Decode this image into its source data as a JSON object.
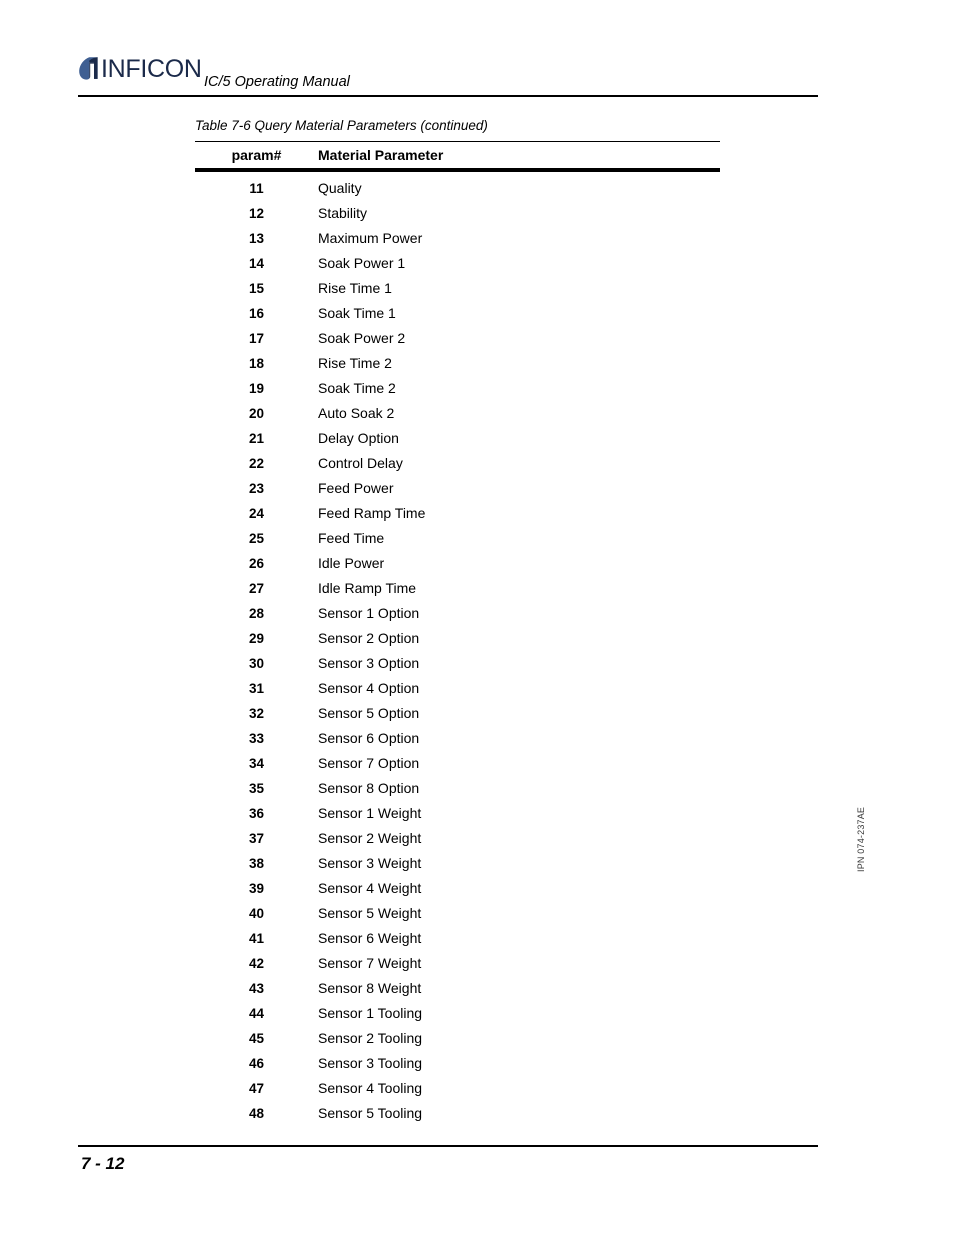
{
  "header": {
    "logo_text": "INFICON",
    "logo_icon": "inficon-droplet-logo",
    "logo_color": "#3f5f92",
    "logo_word_color": "#1b2a4a",
    "manual_title": "IC/5 Operating Manual"
  },
  "table": {
    "caption": "Table 7-6  Query Material Parameters (continued)",
    "columns": [
      "param#",
      "Material Parameter"
    ],
    "rows": [
      {
        "num": "11",
        "name": "Quality"
      },
      {
        "num": "12",
        "name": "Stability"
      },
      {
        "num": "13",
        "name": "Maximum Power"
      },
      {
        "num": "14",
        "name": "Soak Power 1"
      },
      {
        "num": "15",
        "name": "Rise Time 1"
      },
      {
        "num": "16",
        "name": "Soak Time 1"
      },
      {
        "num": "17",
        "name": "Soak Power 2"
      },
      {
        "num": "18",
        "name": "Rise Time 2"
      },
      {
        "num": "19",
        "name": "Soak Time 2"
      },
      {
        "num": "20",
        "name": "Auto Soak 2"
      },
      {
        "num": "21",
        "name": "Delay Option"
      },
      {
        "num": "22",
        "name": "Control Delay"
      },
      {
        "num": "23",
        "name": "Feed Power"
      },
      {
        "num": "24",
        "name": "Feed Ramp Time"
      },
      {
        "num": "25",
        "name": "Feed Time"
      },
      {
        "num": "26",
        "name": "Idle Power"
      },
      {
        "num": "27",
        "name": "Idle Ramp Time"
      },
      {
        "num": "28",
        "name": "Sensor 1 Option"
      },
      {
        "num": "29",
        "name": "Sensor 2 Option"
      },
      {
        "num": "30",
        "name": "Sensor 3 Option"
      },
      {
        "num": "31",
        "name": "Sensor 4 Option"
      },
      {
        "num": "32",
        "name": "Sensor 5 Option"
      },
      {
        "num": "33",
        "name": "Sensor 6 Option"
      },
      {
        "num": "34",
        "name": "Sensor 7 Option"
      },
      {
        "num": "35",
        "name": "Sensor 8 Option"
      },
      {
        "num": "36",
        "name": "Sensor 1 Weight"
      },
      {
        "num": "37",
        "name": "Sensor 2 Weight"
      },
      {
        "num": "38",
        "name": "Sensor 3 Weight"
      },
      {
        "num": "39",
        "name": "Sensor 4 Weight"
      },
      {
        "num": "40",
        "name": "Sensor 5 Weight"
      },
      {
        "num": "41",
        "name": "Sensor 6 Weight"
      },
      {
        "num": "42",
        "name": "Sensor 7 Weight"
      },
      {
        "num": "43",
        "name": "Sensor 8 Weight"
      },
      {
        "num": "44",
        "name": "Sensor 1 Tooling"
      },
      {
        "num": "45",
        "name": "Sensor 2 Tooling"
      },
      {
        "num": "46",
        "name": "Sensor 3 Tooling"
      },
      {
        "num": "47",
        "name": "Sensor 4 Tooling"
      },
      {
        "num": "48",
        "name": "Sensor 5 Tooling"
      }
    ]
  },
  "side": {
    "part_code": "IPN 074-237AE"
  },
  "footer": {
    "page_number": "7 - 12"
  }
}
